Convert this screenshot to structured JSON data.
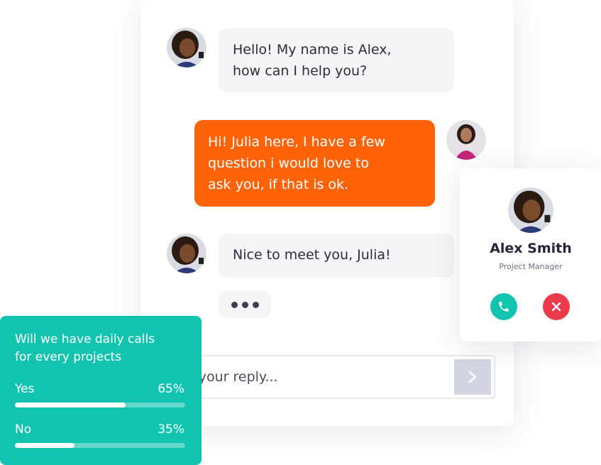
{
  "conversation": {
    "messages": [
      {
        "sender": "Alex",
        "direction": "incoming",
        "lines": [
          "Hello! My name is Alex,",
          "how can I help you?"
        ]
      },
      {
        "sender": "Julia",
        "direction": "outgoing",
        "lines": [
          "Hi! Julia here, I have a few",
          "question i would love to",
          "ask you, if that is ok."
        ]
      },
      {
        "sender": "Alex",
        "direction": "incoming",
        "lines": [
          "Nice to meet you, Julia!"
        ]
      }
    ],
    "typing_indicator": "typing"
  },
  "reply": {
    "placeholder": "e your reply..."
  },
  "profile": {
    "name": "Alex Smith",
    "role": "Project Manager",
    "accept_icon": "phone-icon",
    "decline_icon": "close-icon"
  },
  "poll": {
    "question_lines": [
      "Will we have daily calls",
      "for every projects"
    ],
    "options": [
      {
        "label": "Yes",
        "percent_text": "65%",
        "fill_fraction": 0.65
      },
      {
        "label": "No",
        "percent_text": "35%",
        "fill_fraction": 0.35
      }
    ]
  },
  "colors": {
    "outgoing_bubble": "#ff6308",
    "incoming_bubble": "#f4f5f7",
    "poll_card": "#12c3b0",
    "accept": "#12c3b0",
    "decline": "#ec3a4a",
    "send_button": "#d3d6e2"
  }
}
